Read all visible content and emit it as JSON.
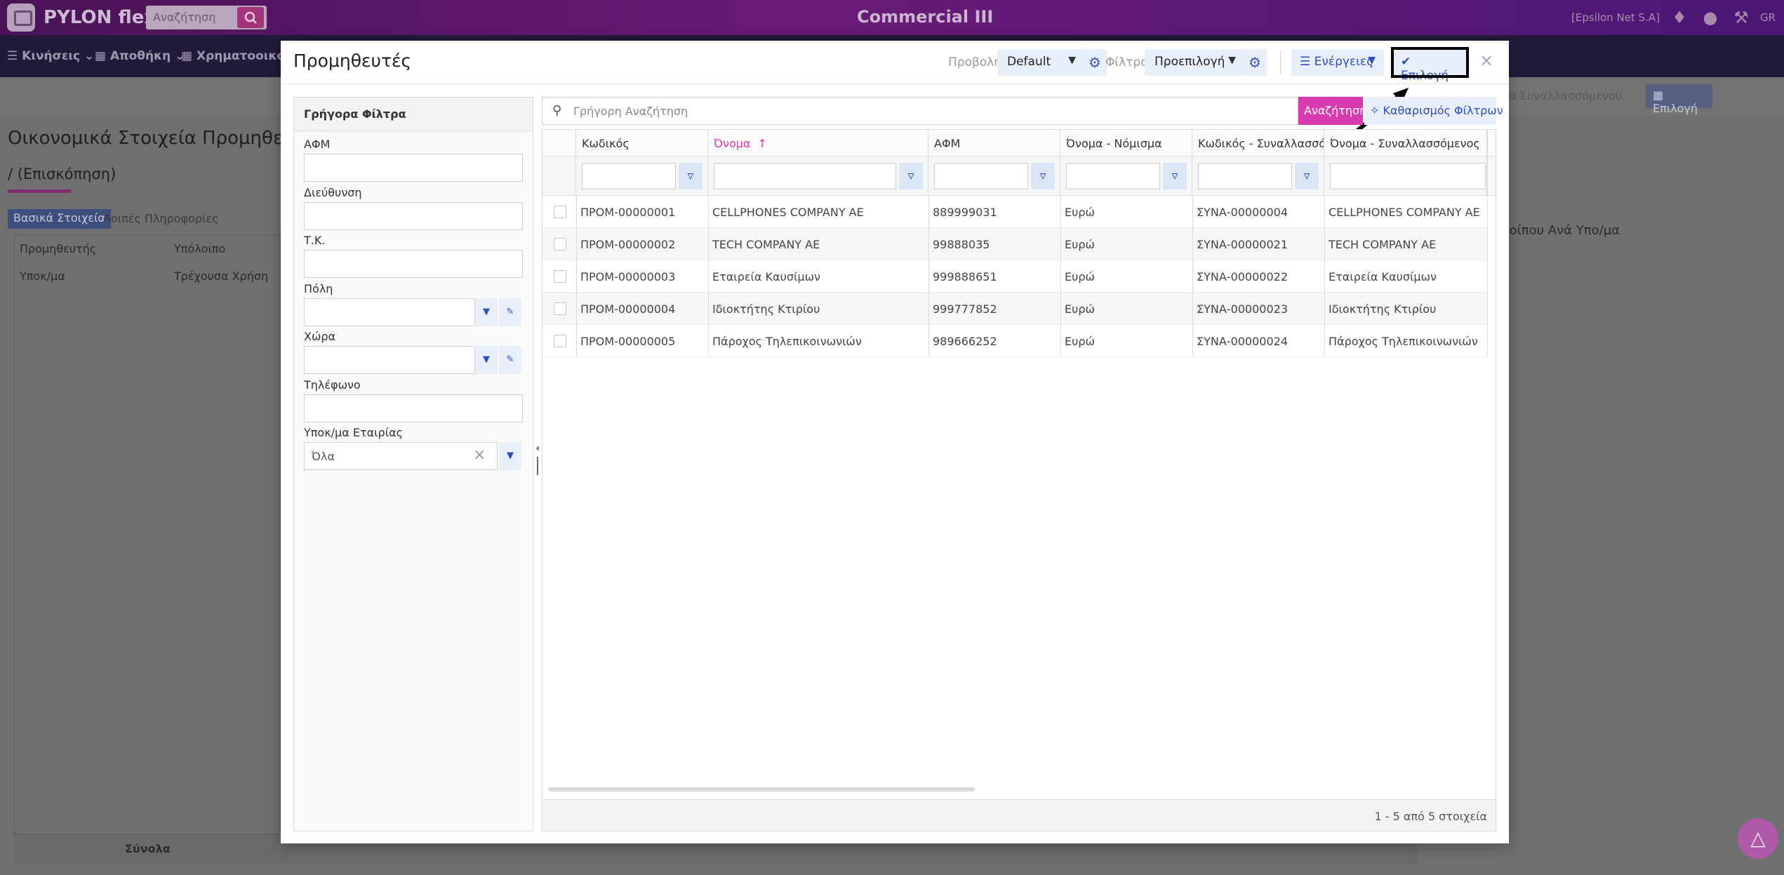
{
  "app": {
    "brand": "PYLON flex",
    "top_search_placeholder": "Αναζήτηση",
    "title": "Commercial III",
    "company": "[Epsilon Net S.A]",
    "lang": "GR"
  },
  "nav": [
    "Κινήσεις",
    "Αποθήκη",
    "Χρηματοοικονομ"
  ],
  "background": {
    "heading": "Οικονομικά Στοιχεία Προμηθευτή",
    "sub": "/ (Επισκόπηση)",
    "tab_basic": "Βασικά Στοιχεία",
    "tab_other": "Λοιπές Πληροφορίες",
    "col_supplier": "Προμηθευτής",
    "col_balance": "Υπόλοιπο",
    "col_branch": "Υποκ/μα",
    "col_year": "Τρέχουσα Χρήση",
    "totals": "Σύνολα",
    "right_button": "Επιλογή",
    "right_text": "α Συναλλασσόμενου",
    "right_text2": "λοίπου Ανά Υπο/μα"
  },
  "modal": {
    "title": "Προμηθευτές",
    "view_label": "Προβολή",
    "view_value": "Default",
    "filters_label": "Φίλτρα",
    "filters_value": "Προεπιλογή",
    "actions_label": "Ενέργειες",
    "select_label": "Επιλογή",
    "close": "×"
  },
  "quick_filters": {
    "title": "Γρήγορα Φίλτρα",
    "afm": "ΑΦΜ",
    "address": "Διεύθυνση",
    "zip": "Τ.Κ.",
    "city": "Πόλη",
    "country": "Χώρα",
    "phone": "Τηλέφωνο",
    "branch": "Υποκ/μα Εταιρίας",
    "branch_value": "Όλα"
  },
  "grid": {
    "quick_search_placeholder": "Γρήγορη Αναζήτηση",
    "search_button": "Αναζήτηση",
    "clear_filters": "Καθαρισμός Φίλτρων",
    "columns": [
      "Κωδικός",
      "Όνομα",
      "ΑΦΜ",
      "Όνομα - Νόμισμα",
      "Κωδικός - Συναλλασσό...",
      "Όνομα - Συναλλασσόμενος"
    ],
    "rows": [
      [
        "ΠΡΟΜ-00000001",
        "CELLPHONES COMPANY AE",
        "889999031",
        "Ευρώ",
        "ΣΥΝΑ-00000004",
        "CELLPHONES COMPANY AE"
      ],
      [
        "ΠΡΟΜ-00000002",
        "TECH COMPANY AE",
        "99888035",
        "Ευρώ",
        "ΣΥΝΑ-00000021",
        "TECH COMPANY AE"
      ],
      [
        "ΠΡΟΜ-00000003",
        "Εταιρεία Καυσίμων",
        "999888651",
        "Ευρώ",
        "ΣΥΝΑ-00000022",
        "Εταιρεία Καυσίμων"
      ],
      [
        "ΠΡΟΜ-00000004",
        "Ιδιοκτήτης Κτιρίου",
        "999777852",
        "Ευρώ",
        "ΣΥΝΑ-00000023",
        "Ιδιοκτήτης Κτιρίου"
      ],
      [
        "ΠΡΟΜ-00000005",
        "Πάροχος Τηλεπικοινωνιών",
        "989666252",
        "Ευρώ",
        "ΣΥΝΑ-00000024",
        "Πάροχος Τηλεπικοινωνιών"
      ]
    ],
    "pager": "1 - 5 από 5 στοιχεία"
  },
  "colors": {
    "accent": "#d83bb0",
    "link_blue": "#2e4fc0",
    "button_bg": "#e9eff8",
    "topbar": "#5d1a6e"
  },
  "icons": [
    "search-icon",
    "gear-icon",
    "menu-icon",
    "check-icon",
    "filter-icon",
    "clear-filter-icon",
    "pencil-icon",
    "bell-icon",
    "user-icon",
    "close-icon",
    "chart-icon"
  ]
}
